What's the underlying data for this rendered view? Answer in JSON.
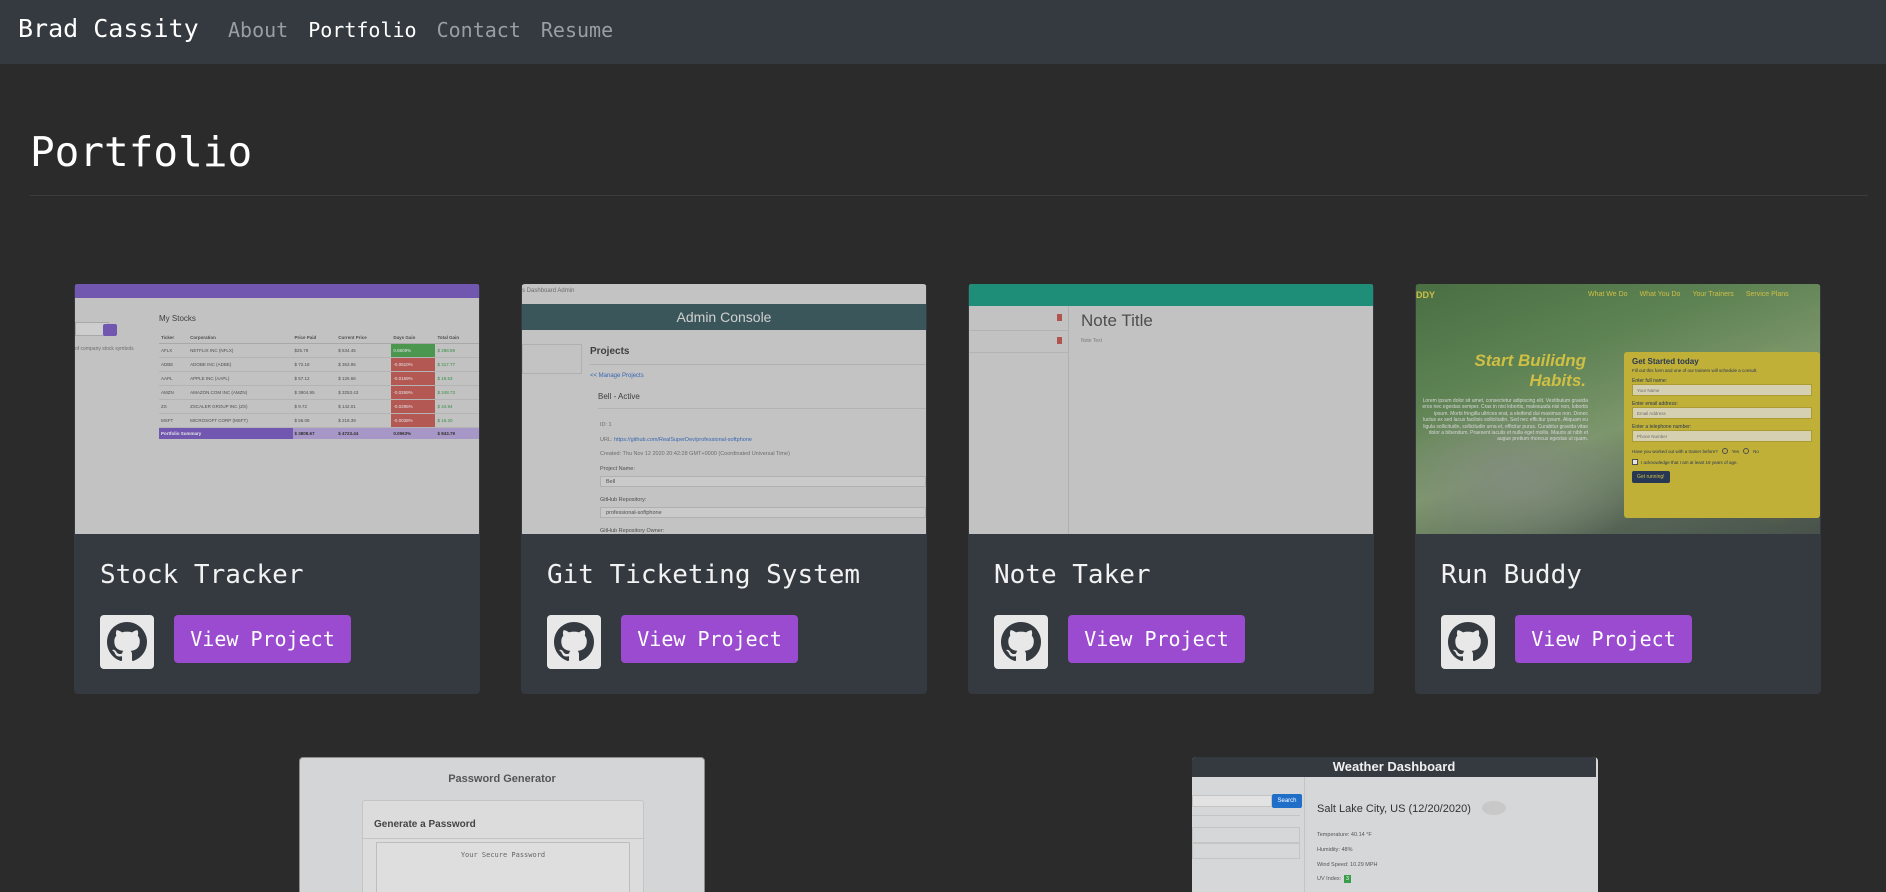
{
  "nav": {
    "brand": "Brad Cassity",
    "links": [
      "About",
      "Portfolio",
      "Contact",
      "Resume"
    ]
  },
  "page": {
    "title": "Portfolio"
  },
  "projects": [
    {
      "title": "Stock Tracker",
      "button": "View Project",
      "preview": {
        "heading": "My Stocks",
        "side_note": "of company stock symbols",
        "headers": [
          "Ticker",
          "Corporation",
          "Price Paid",
          "Current Price",
          "Days Gain",
          "Total Gain"
        ],
        "rows": [
          [
            "AFLX",
            "NETFLIX INC (NFLX)",
            "$25.79",
            "$ 534.45",
            "0.8609%",
            "$ 288.59"
          ],
          [
            "ADBE",
            "ADOBE INC (ADBE)",
            "$ 72.18",
            "$ 353.95",
            "-0.0510%",
            "$ 317.77"
          ],
          [
            "AAPL",
            "APPLE INC (AAPL)",
            "$ 57.12",
            "$ 126.66",
            "-0.0159%",
            "$ 19.53"
          ],
          [
            "AMZN",
            "AMAZON.COM INC (AMZN)",
            "$ 3904.95",
            "$ 3253.43",
            "-0.0269%",
            "$ 248.73"
          ],
          [
            "ZS",
            "ZSCALER GROUP INC (ZS)",
            "$ 9.72",
            "$ 142.01",
            "-0.0295%",
            "$ 44.94"
          ],
          [
            "MSFT",
            "MICROSOFT CORP (MSFT)",
            "$ 56.08",
            "$ 218.39",
            "-0.0038%",
            "$ 16.20"
          ]
        ],
        "summary": [
          "Portfolio Summary",
          "$ 3808.67",
          "$ 4723.44",
          "0.0963%",
          "$ 843.79"
        ]
      }
    },
    {
      "title": "Git Ticketing System",
      "button": "View Project",
      "preview": {
        "crumbs": "s  Dashboard  Admin",
        "banner": "Admin Console",
        "section": "Projects",
        "back_link": "<< Manage Projects",
        "item": "Bell - Active",
        "id": "ID: 1",
        "url_label": "URL:",
        "url": "https://github.com/RealSuperDev/professional-softphone",
        "created": "Created: Thu Nov 12 2020 20:42:28 GMT+0000 (Coordinated Universal Time)",
        "project_name_label": "Project Name:",
        "project_name": "Bell",
        "repo_label": "GitHub Repository:",
        "repo": "professional-softphone",
        "more": "GitHub Repository Owner:"
      }
    },
    {
      "title": "Note Taker",
      "button": "View Project",
      "preview": {
        "note_title": "Note Title",
        "note_text": "Note Text"
      }
    },
    {
      "title": "Run Buddy",
      "button": "View Project",
      "preview": {
        "logo": "DDY",
        "nav": [
          "What We Do",
          "What You Do",
          "Your Trainers",
          "Service Plans"
        ],
        "headline1": "Start Builidng",
        "headline2": "Habits.",
        "body": "Lorem ipsum dolor sit amet, consectetur adipiscing elit. Vestibulum gravida eros nec egestas semper. Cras in nisi lobortis, malesuada nisi non, lobortis ipsum. Morbi fringilla ultrices erat, a eleifend dui maximus non. Donec luctus ex sed lacus facilisis sollicitudin. Sed nec efficitur ipsum. Aliquam eu ligula sollicitudin, sollicitudin urna et, efficitur purus. Curabitur gravida vitae dolor a bibendum. Praesent iaculis et nulla eget mollis. Mauris at nibh et augue pretium rhoncus egestas ut quam.",
        "form_title": "Get Started today",
        "form_sub": "Fill out this form and one of our trainers will schedule a consult.",
        "labels": [
          "Enter full name:",
          "Enter email address:",
          "Enter a telephone number:"
        ],
        "placeholders": [
          "Your Name",
          "Email Address",
          "Phone Number"
        ],
        "question": "Have you worked out with a trainer before?",
        "yes": "Yes",
        "no": "No",
        "ack": "I acknowledge that I am at least 18 years of age.",
        "submit": "Get running!"
      }
    }
  ],
  "lower_projects": [
    {
      "preview": {
        "heading": "Password Generator",
        "card_title": "Generate a Password",
        "placeholder": "Your Secure Password"
      }
    },
    {
      "preview": {
        "banner": "Weather Dashboard",
        "search": "Search",
        "city": "Salt Lake City, US (12/20/2020)",
        "temp": "Temperature: 40.14 °F",
        "humidity": "Humidity: 48%",
        "wind": "Wind Speed: 10.29 MPH",
        "uv_label": "UV Index:",
        "uv": "3"
      }
    }
  ],
  "colors": {
    "accent": "#9b4bd0",
    "card_bg": "#343a40",
    "page_bg": "#2b2b2b",
    "nav_bg": "#343a40"
  },
  "icons": [
    "github-icon"
  ]
}
